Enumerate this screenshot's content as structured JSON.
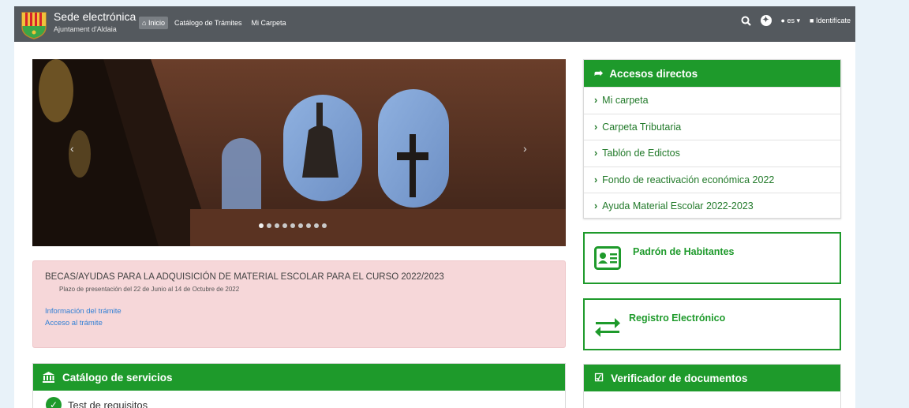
{
  "brand": {
    "title": "Sede electrónica",
    "subtitle": "Ajuntament d'Aldaia"
  },
  "nav": {
    "home": "Inicio",
    "catalog": "Catálogo de Trámites",
    "folder": "Mi Carpeta",
    "language": "es",
    "login": "Identifícate"
  },
  "alert": {
    "title": "BECAS/AYUDAS PARA LA ADQUISICIÓN DE MATERIAL ESCOLAR PARA EL CURSO 2022/2023",
    "subtitle": "Plazo de presentación del 22 de Junio al 14 de Octubre de 2022",
    "link_info": "Información del trámite",
    "link_access": "Acceso al trámite"
  },
  "accesos": {
    "title": "Accesos directos",
    "items": [
      {
        "label": "Mi carpeta"
      },
      {
        "label": "Carpeta Tributaria"
      },
      {
        "label": "Tablón de Edictos"
      },
      {
        "label": "Fondo de reactivación económica 2022"
      },
      {
        "label": "Ayuda Material Escolar 2022-2023"
      }
    ]
  },
  "boxes": {
    "padron": "Padrón de Habitantes",
    "registro": "Registro Electrónico"
  },
  "catalog": {
    "title": "Catálogo de servicios",
    "item": "Test de requisitos"
  },
  "verificador": {
    "title": "Verificador de documentos"
  },
  "colors": {
    "accent": "#1e9a2b",
    "navbar": "#54595e",
    "alert_bg": "#f6d7d9",
    "link": "#2f7fd5"
  },
  "carousel": {
    "slide_count": 9,
    "active_slide": 1
  }
}
